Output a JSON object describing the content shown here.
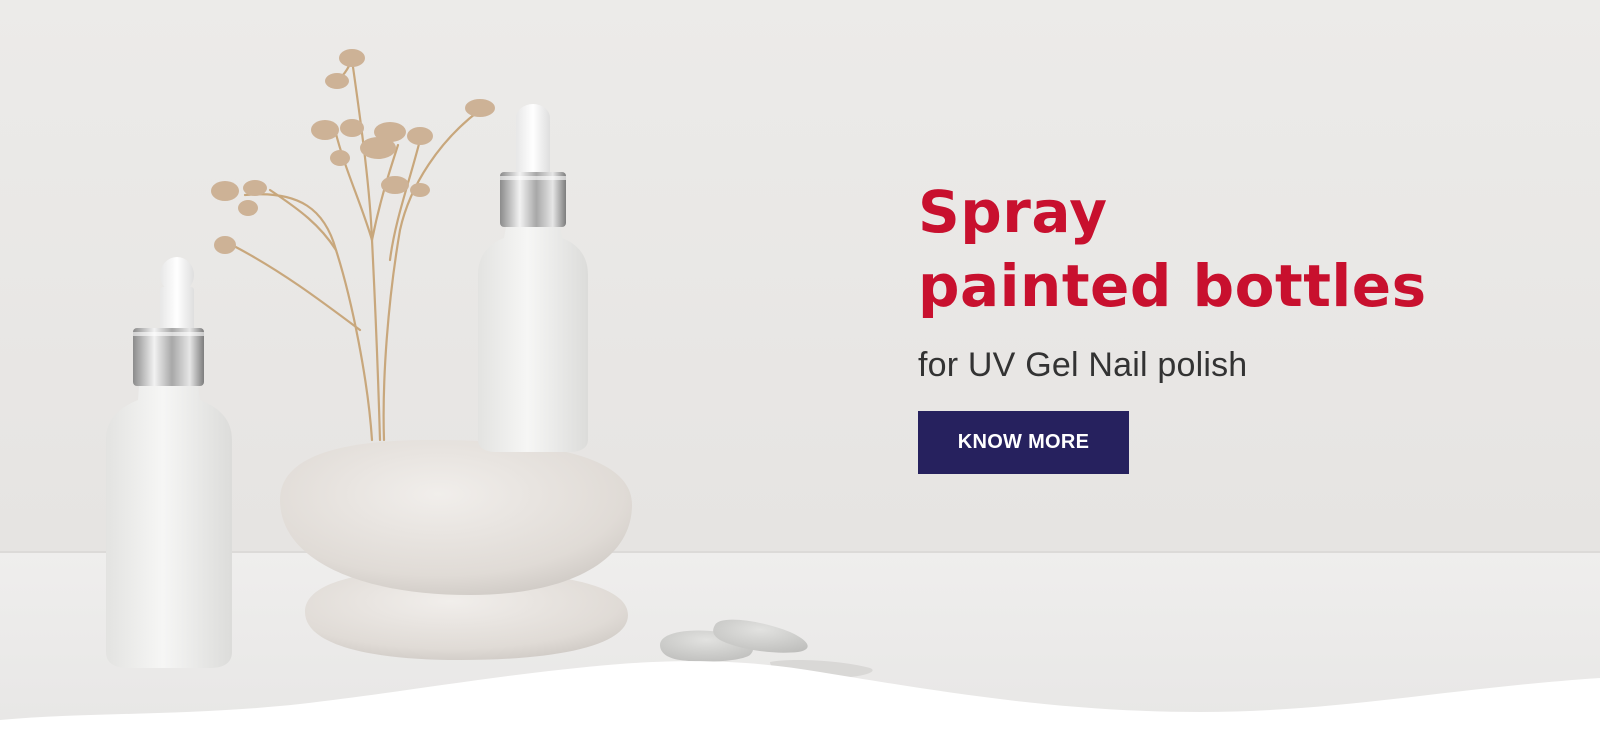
{
  "hero": {
    "headline_line1": "Spray",
    "headline_line2": "painted bottles",
    "subhead": "for UV Gel Nail polish",
    "cta_label": "KNOW MORE"
  },
  "colors": {
    "headline": "#c8102e",
    "button_bg": "#26215e",
    "button_text": "#ffffff",
    "subhead": "#333333"
  },
  "image": {
    "description_icon": "product-photo",
    "wave": "white-wave-divider"
  }
}
